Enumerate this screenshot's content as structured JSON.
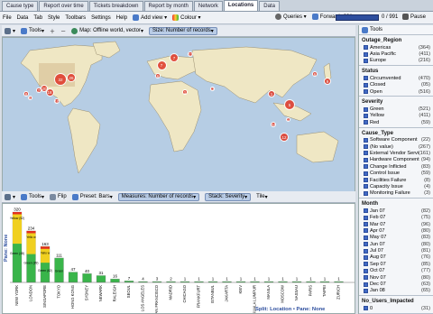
{
  "tabs": [
    "Cause type",
    "Report over time",
    "Tickets breakdown",
    "Report by month",
    "Network",
    "Locations",
    "Data"
  ],
  "active_tab": "Locations",
  "menu": {
    "items": [
      "File",
      "Data",
      "Tab",
      "Style",
      "Toolbars",
      "Settings",
      "Help"
    ],
    "add_view": "Add view",
    "colour": "Colour",
    "queries": "Queries",
    "forward": "Forward",
    "progress_left": "991",
    "progress_right": "0 / 991",
    "pause": "Pause"
  },
  "map_toolbar": {
    "tools": "Tools",
    "map": "Map: Offline world, vector",
    "size": "Size: Number of records"
  },
  "map_bubbles": [
    {
      "label": "32"
    },
    {
      "label": "20"
    },
    {
      "label": "7"
    },
    {
      "label": "18"
    },
    {
      "label": "26"
    },
    {
      "label": "8"
    },
    {
      "label": "5"
    },
    {
      "label": "10"
    },
    {
      "label": "7"
    },
    {
      "label": "7"
    },
    {
      "label": "11"
    },
    {
      "label": "6"
    },
    {
      "label": "1"
    },
    {
      "label": "11"
    },
    {
      "label": "1"
    },
    {
      "label": "5"
    },
    {
      "label": "34"
    },
    {
      "label": "1"
    },
    {
      "label": "12"
    },
    {
      "label": "6"
    },
    {
      "label": "9"
    }
  ],
  "chart_toolbar": {
    "tools": "Tools",
    "flip": "Flip",
    "preset": "Preset: Bars",
    "measures": "Measures: Number of records",
    "stack": "Stack: Severity",
    "tile": "Tile"
  },
  "chart_footer": "Split: Location • Pane: None",
  "pane_label": "Pane: None",
  "chart_data": {
    "type": "bar",
    "categories": [
      "NEW YORK",
      "LONDON",
      "SINGAPORE",
      "TOKYO",
      "HONG KONG",
      "SYDNEY",
      "NEWARK",
      "RALEIGH",
      "SEOUL",
      "LOS ANGELES",
      "SAN FRANCISCO",
      "MADRID",
      "CHICAGO",
      "FRANKFURT",
      "ISTANBUL",
      "JAKARTA",
      "KIEV",
      "KUALA LUMPUR",
      "MANILA",
      "MOSCOW",
      "NASSAU",
      "PARIS",
      "TAIPEI",
      "ZURICH"
    ],
    "values": [
      320,
      234,
      163,
      111,
      47,
      40,
      31,
      16,
      7,
      4,
      3,
      2,
      1,
      1,
      1,
      1,
      1,
      1,
      1,
      1,
      1,
      1,
      1,
      1
    ],
    "stack_labels": {
      "NEW YORK": [
        "Yellow (52)",
        "Green (48)"
      ],
      "LONDON": [
        "Yello w",
        "Green (89)"
      ],
      "SINGAPORE": [
        "Yello w",
        "Green (62)"
      ],
      "TOKYO": [
        "Green"
      ]
    }
  },
  "side": {
    "tools": "Tools",
    "groups": [
      {
        "title": "Outage_Region",
        "items": [
          {
            "l": "Americas",
            "c": "(364)"
          },
          {
            "l": "Asia Pacific",
            "c": "(411)"
          },
          {
            "l": "Europe",
            "c": "(216)"
          }
        ]
      },
      {
        "title": "Status",
        "items": [
          {
            "l": "Circumvented",
            "c": "(470)"
          },
          {
            "l": "Closed",
            "c": "(05)"
          },
          {
            "l": "Open",
            "c": "(516)"
          }
        ]
      },
      {
        "title": "Severity",
        "items": [
          {
            "l": "Green",
            "c": "(521)"
          },
          {
            "l": "Yellow",
            "c": "(411)"
          },
          {
            "l": "Red",
            "c": "(59)"
          }
        ]
      },
      {
        "title": "Cause_Type",
        "items": [
          {
            "l": "Software Component",
            "c": "(22)"
          },
          {
            "l": "(No value)",
            "c": "(267)"
          },
          {
            "l": "External Vendor Servi",
            "c": "(161)"
          },
          {
            "l": "Hardware Component",
            "c": "(94)"
          },
          {
            "l": "Change Inflicted",
            "c": "(83)"
          },
          {
            "l": "Control Issue",
            "c": "(59)"
          },
          {
            "l": "Facilities Failure",
            "c": "(8)"
          },
          {
            "l": "Capacity Issue",
            "c": "(4)"
          },
          {
            "l": "Monitoring Failure",
            "c": "(3)"
          }
        ]
      },
      {
        "title": "Month",
        "items": [
          {
            "l": "Jan 07",
            "c": "(82)"
          },
          {
            "l": "Feb 07",
            "c": "(75)"
          },
          {
            "l": "Mar 07",
            "c": "(96)"
          },
          {
            "l": "Apr 07",
            "c": "(80)"
          },
          {
            "l": "May 07",
            "c": "(83)"
          },
          {
            "l": "Jun 07",
            "c": "(80)"
          },
          {
            "l": "Jul 07",
            "c": "(81)"
          },
          {
            "l": "Aug 07",
            "c": "(76)"
          },
          {
            "l": "Sep 07",
            "c": "(85)"
          },
          {
            "l": "Oct 07",
            "c": "(77)"
          },
          {
            "l": "Nov 07",
            "c": "(80)"
          },
          {
            "l": "Dec 07",
            "c": "(63)"
          },
          {
            "l": "Jan 08",
            "c": "(65)"
          }
        ]
      },
      {
        "title": "No_Users_Impacted",
        "items": [
          {
            "l": "0",
            "c": "(31)"
          }
        ]
      }
    ]
  },
  "colors": {
    "bubble": "#e04030",
    "land": "#efe7c4",
    "sea": "#b6cde4",
    "green": "#39b54a",
    "yellow": "#f0d020",
    "red": "#e03020",
    "accent": "#2d4e9e"
  }
}
